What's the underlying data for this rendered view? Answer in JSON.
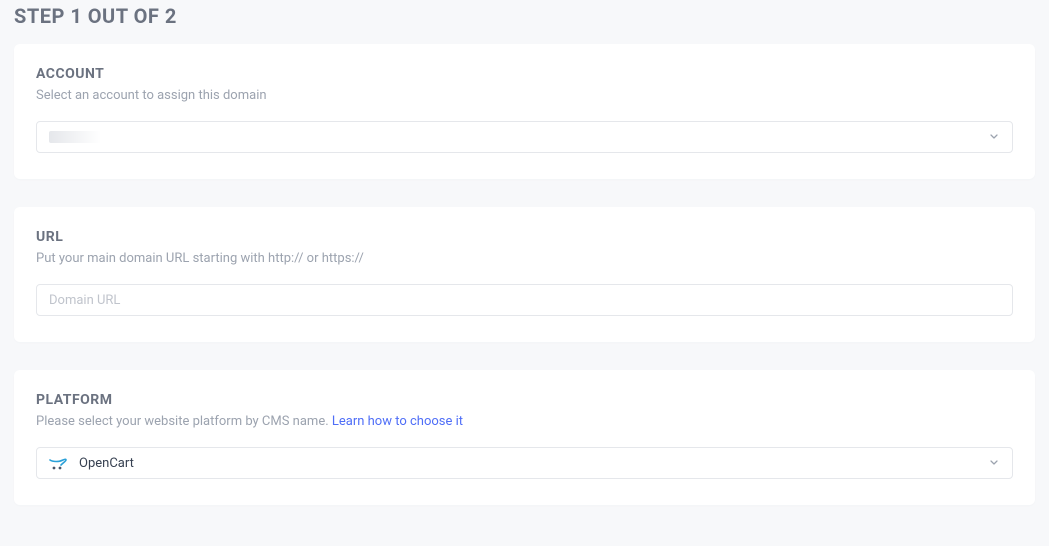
{
  "page": {
    "title": "STEP 1 OUT OF 2"
  },
  "account": {
    "heading": "ACCOUNT",
    "sub": "Select an account to assign this domain",
    "value": ""
  },
  "url": {
    "heading": "URL",
    "sub": "Put your main domain URL starting with http:// or https://",
    "placeholder": "Domain URL",
    "value": ""
  },
  "platform": {
    "heading": "PLATFORM",
    "sub_prefix": "Please select your website platform by CMS name.  ",
    "learn_link": "Learn how to choose it",
    "selected": "OpenCart"
  }
}
